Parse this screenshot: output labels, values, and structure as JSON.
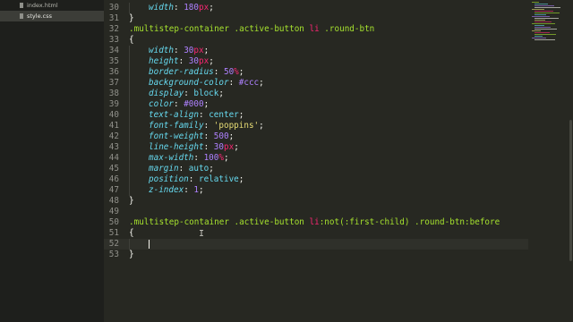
{
  "sidebar": {
    "files": [
      {
        "name": "index.html",
        "active": false
      },
      {
        "name": "style.css",
        "active": true
      }
    ]
  },
  "editor": {
    "current_line": "52",
    "lines": [
      {
        "n": "30",
        "tokens": [
          {
            "t": "prop",
            "s": "width"
          },
          {
            "t": "pun",
            "s": ": "
          },
          {
            "t": "num",
            "s": "180"
          },
          {
            "t": "unit",
            "s": "px"
          },
          {
            "t": "pun",
            "s": ";"
          }
        ]
      },
      {
        "n": "31",
        "tokens": [
          {
            "t": "pun",
            "s": "}"
          }
        ]
      },
      {
        "n": "32",
        "tokens": [
          {
            "t": "sel",
            "s": ".multistep-container .active-button "
          },
          {
            "t": "kw",
            "s": "li"
          },
          {
            "t": "sel",
            "s": " .round-btn"
          }
        ]
      },
      {
        "n": "33",
        "tokens": [
          {
            "t": "pun",
            "s": "{"
          }
        ]
      },
      {
        "n": "34",
        "tokens": [
          {
            "t": "prop",
            "s": "width"
          },
          {
            "t": "pun",
            "s": ": "
          },
          {
            "t": "num",
            "s": "30"
          },
          {
            "t": "unit",
            "s": "px"
          },
          {
            "t": "pun",
            "s": ";"
          }
        ]
      },
      {
        "n": "35",
        "tokens": [
          {
            "t": "prop",
            "s": "height"
          },
          {
            "t": "pun",
            "s": ": "
          },
          {
            "t": "num",
            "s": "30"
          },
          {
            "t": "unit",
            "s": "px"
          },
          {
            "t": "pun",
            "s": ";"
          }
        ]
      },
      {
        "n": "36",
        "tokens": [
          {
            "t": "prop",
            "s": "border-radius"
          },
          {
            "t": "pun",
            "s": ": "
          },
          {
            "t": "num",
            "s": "50"
          },
          {
            "t": "unit",
            "s": "%"
          },
          {
            "t": "pun",
            "s": ";"
          }
        ]
      },
      {
        "n": "37",
        "tokens": [
          {
            "t": "prop",
            "s": "background-color"
          },
          {
            "t": "pun",
            "s": ": "
          },
          {
            "t": "num",
            "s": "#ccc"
          },
          {
            "t": "pun",
            "s": ";"
          }
        ]
      },
      {
        "n": "38",
        "tokens": [
          {
            "t": "prop",
            "s": "display"
          },
          {
            "t": "pun",
            "s": ": "
          },
          {
            "t": "val",
            "s": "block"
          },
          {
            "t": "pun",
            "s": ";"
          }
        ]
      },
      {
        "n": "39",
        "tokens": [
          {
            "t": "prop",
            "s": "color"
          },
          {
            "t": "pun",
            "s": ": "
          },
          {
            "t": "num",
            "s": "#000"
          },
          {
            "t": "pun",
            "s": ";"
          }
        ]
      },
      {
        "n": "40",
        "tokens": [
          {
            "t": "prop",
            "s": "text-align"
          },
          {
            "t": "pun",
            "s": ": "
          },
          {
            "t": "val",
            "s": "center"
          },
          {
            "t": "pun",
            "s": ";"
          }
        ]
      },
      {
        "n": "41",
        "tokens": [
          {
            "t": "prop",
            "s": "font-family"
          },
          {
            "t": "pun",
            "s": ": "
          },
          {
            "t": "str",
            "s": "'poppins'"
          },
          {
            "t": "pun",
            "s": ";"
          }
        ]
      },
      {
        "n": "42",
        "tokens": [
          {
            "t": "prop",
            "s": "font-weight"
          },
          {
            "t": "pun",
            "s": ": "
          },
          {
            "t": "num",
            "s": "500"
          },
          {
            "t": "pun",
            "s": ";"
          }
        ]
      },
      {
        "n": "43",
        "tokens": [
          {
            "t": "prop",
            "s": "line-height"
          },
          {
            "t": "pun",
            "s": ": "
          },
          {
            "t": "num",
            "s": "30"
          },
          {
            "t": "unit",
            "s": "px"
          },
          {
            "t": "pun",
            "s": ";"
          }
        ]
      },
      {
        "n": "44",
        "tokens": [
          {
            "t": "prop",
            "s": "max-width"
          },
          {
            "t": "pun",
            "s": ": "
          },
          {
            "t": "num",
            "s": "100"
          },
          {
            "t": "unit",
            "s": "%"
          },
          {
            "t": "pun",
            "s": ";"
          }
        ]
      },
      {
        "n": "45",
        "tokens": [
          {
            "t": "prop",
            "s": "margin"
          },
          {
            "t": "pun",
            "s": ": "
          },
          {
            "t": "val",
            "s": "auto"
          },
          {
            "t": "pun",
            "s": ";"
          }
        ]
      },
      {
        "n": "46",
        "tokens": [
          {
            "t": "prop",
            "s": "position"
          },
          {
            "t": "pun",
            "s": ": "
          },
          {
            "t": "val",
            "s": "relative"
          },
          {
            "t": "pun",
            "s": ";"
          }
        ]
      },
      {
        "n": "47",
        "tokens": [
          {
            "t": "prop",
            "s": "z-index"
          },
          {
            "t": "pun",
            "s": ": "
          },
          {
            "t": "num",
            "s": "1"
          },
          {
            "t": "pun",
            "s": ";"
          }
        ]
      },
      {
        "n": "48",
        "tokens": [
          {
            "t": "pun",
            "s": "}"
          }
        ]
      },
      {
        "n": "49",
        "tokens": []
      },
      {
        "n": "50",
        "tokens": [
          {
            "t": "sel",
            "s": ".multistep-container .active-button "
          },
          {
            "t": "kw",
            "s": "li"
          },
          {
            "t": "sel",
            "s": ":not(:first-child) .round-btn"
          },
          {
            "t": "sel",
            "s": ":before"
          }
        ]
      },
      {
        "n": "51",
        "tokens": [
          {
            "t": "pun",
            "s": "{"
          }
        ]
      },
      {
        "n": "52",
        "tokens": []
      },
      {
        "n": "53",
        "tokens": [
          {
            "t": "pun",
            "s": "}"
          }
        ]
      }
    ]
  },
  "colors": {
    "background": "#272822",
    "sidebar": "#1e1f1c",
    "selector": "#a6e22e",
    "keyword": "#f92672",
    "property": "#66d9ef",
    "number": "#ae81ff",
    "string": "#e6db74",
    "foreground": "#f8f8f2"
  }
}
